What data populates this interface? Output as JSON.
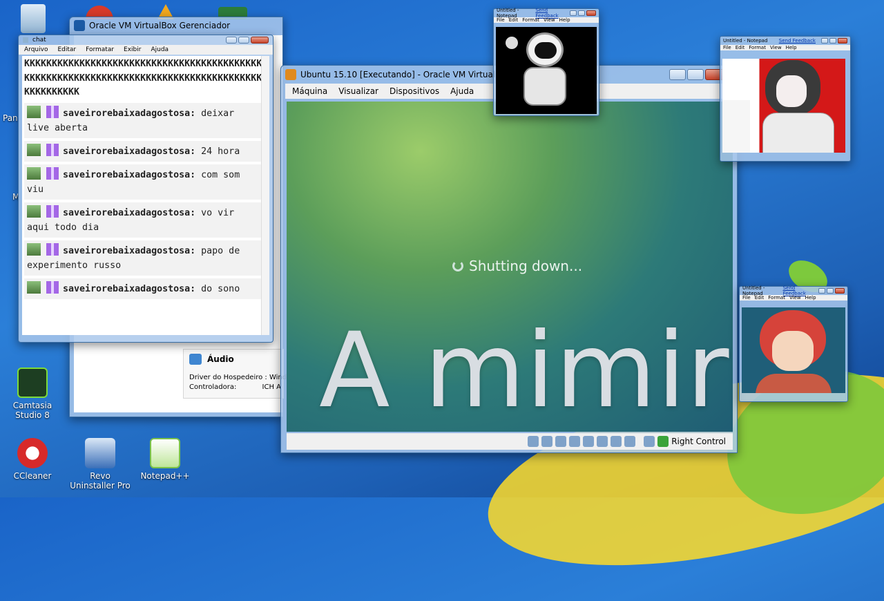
{
  "desktop": {
    "icons": [
      {
        "label": "Camtasia Studio 8",
        "color": "#1d3e22"
      },
      {
        "label": "CCleaner",
        "color": "#d72a2a"
      },
      {
        "label": "Revo Uninstaller Pro",
        "color": "#3b6fb8"
      },
      {
        "label": "Notepad++",
        "color": "#7cc34a"
      }
    ],
    "partial_left_1": "Pan",
    "partial_left_2": "M"
  },
  "chat_window": {
    "title": "chat",
    "menu": [
      "Arquivo",
      "Editar",
      "Formatar",
      "Exibir",
      "Ajuda"
    ],
    "spam": "KKKKKKKKKKKKKKKKKKKKKKKKKKKKKKKKKKKKKKKKKKKKKKKKKKKKKKKKKKKKKKKKKKKKKKKKKKKKKKKKKKKKKKKKKKKKKKKK",
    "messages": [
      {
        "user": "saveirorebaixadagostosa:",
        "text": "deixar live aberta"
      },
      {
        "user": "saveirorebaixadagostosa:",
        "text": "24 hora"
      },
      {
        "user": "saveirorebaixadagostosa:",
        "text": "com som viu"
      },
      {
        "user": "saveirorebaixadagostosa:",
        "text": "vo vir aqui todo dia"
      },
      {
        "user": "saveirorebaixadagostosa:",
        "text": "papo de experimento russo"
      },
      {
        "user": "saveirorebaixadagostosa:",
        "text": "do sono"
      }
    ]
  },
  "manager_window": {
    "title": "Oracle VM VirtualBox Gerenciador",
    "audio_heading": "Áudio",
    "audio_driver_label": "Driver do Hospedeiro :",
    "audio_driver_value": "Wind",
    "audio_controller_label": "Controladora:",
    "audio_controller_value": "ICH A"
  },
  "vm_window": {
    "title": "Ubuntu 15.10 [Executando] - Oracle VM VirtualBox",
    "menu": [
      "Máquina",
      "Visualizar",
      "Dispositivos",
      "Ajuda"
    ],
    "status_text": "Shutting down...",
    "host_key": "Right Control"
  },
  "overlay_text": "A mimir",
  "notepads": [
    {
      "title": "Untitled - Notepad",
      "feedback": "Send Feedback",
      "menu": [
        "File",
        "Edit",
        "Format",
        "View",
        "Help"
      ],
      "image": "astronaut"
    },
    {
      "title": "Untitled - Notepad",
      "feedback": "Send Feedback",
      "menu": [
        "File",
        "Edit",
        "Format",
        "View",
        "Help"
      ],
      "image": "anime-girl"
    },
    {
      "title": "Untitled - Notepad",
      "feedback": "Send Feedback",
      "menu": [
        "File",
        "Edit",
        "Format",
        "View",
        "Help"
      ],
      "image": "red-hair-boy"
    }
  ]
}
